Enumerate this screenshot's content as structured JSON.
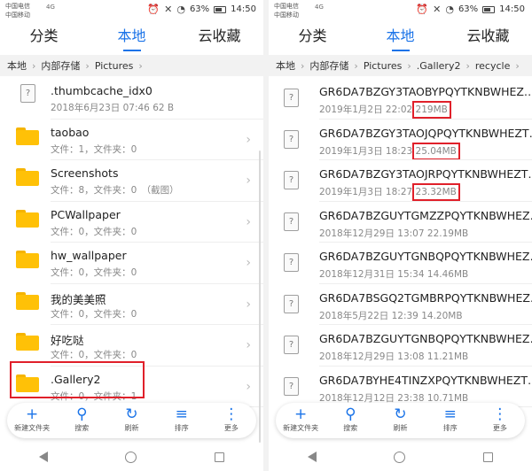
{
  "status_bar": {
    "carrier1": "中国电信",
    "carrier2": "中国移动",
    "network": "4G",
    "battery": "63%",
    "time": "14:50"
  },
  "tabs": [
    "分类",
    "本地",
    "云收藏"
  ],
  "active_tab": 1,
  "left": {
    "breadcrumb": [
      "本地",
      "内部存储",
      "Pictures"
    ],
    "items": [
      {
        "type": "file",
        "name": ".thumbcache_idx0",
        "meta": "2018年6月23日 07:46 62 B"
      },
      {
        "type": "folder",
        "name": "taobao",
        "meta": "文件：1，文件夹：0"
      },
      {
        "type": "folder",
        "name": "Screenshots",
        "meta": "文件：8，文件夹：0　（截图）"
      },
      {
        "type": "folder",
        "name": "PCWallpaper",
        "meta": "文件：0，文件夹：0"
      },
      {
        "type": "folder",
        "name": "hw_wallpaper",
        "meta": "文件：0，文件夹：0"
      },
      {
        "type": "folder",
        "name": "我的美美照",
        "meta": "文件：0，文件夹：0"
      },
      {
        "type": "folder",
        "name": "好吃哒",
        "meta": "文件：0，文件夹：0"
      },
      {
        "type": "folder",
        "name": ".Gallery2",
        "meta": "文件：0，文件夹：1"
      }
    ]
  },
  "right": {
    "breadcrumb": [
      "本地",
      "内部存储",
      "Pictures",
      ".Gallery2",
      "recycle"
    ],
    "items": [
      {
        "name": "GR6DA7BZGY3TAOBYPQYTKNBWHEZ…",
        "date": "2019年1月2日 22:02",
        "size": "219MB"
      },
      {
        "name": "GR6DA7BZGY3TAOJQPQYTKNBWHEZT…",
        "date": "2019年1月3日 18:23",
        "size": "25.04MB"
      },
      {
        "name": "GR6DA7BZGY3TAOJRPQYTKNBWHEZT…",
        "date": "2019年1月3日 18:27",
        "size": "23.32MB"
      },
      {
        "name": "GR6DA7BZGUYTGMZZPQYTKNBWHEZ…",
        "date": "2018年12月29日 13:07",
        "size": "22.19MB"
      },
      {
        "name": "GR6DA7BZGUYTGNBQPQYTKNBWHEZ…",
        "date": "2018年12月31日 15:34",
        "size": "14.46MB"
      },
      {
        "name": "GR6DA7BSGQ2TGMBRPQYTKNBWHEZ…",
        "date": "2018年5月22日 12:39",
        "size": "14.20MB"
      },
      {
        "name": "GR6DA7BZGUYTGNBQPQYTKNBWHEZ…",
        "date": "2018年12月29日 13:08",
        "size": "11.21MB"
      },
      {
        "name": "GR6DA7BYHE4TINZXPQYTKNBWHEZT…",
        "date": "2018年12月12日 23:38",
        "size": "10.71MB"
      }
    ]
  },
  "toolbar": [
    {
      "icon": "plus-icon",
      "label": "新建文件夹"
    },
    {
      "icon": "search-icon",
      "label": "搜索"
    },
    {
      "icon": "refresh-icon",
      "label": "刷新"
    },
    {
      "icon": "sort-icon",
      "label": "排序"
    },
    {
      "icon": "more-icon",
      "label": "更多"
    }
  ],
  "colors": {
    "accent": "#1a73e8",
    "highlight": "#e0202a",
    "folder": "#ffc107"
  }
}
